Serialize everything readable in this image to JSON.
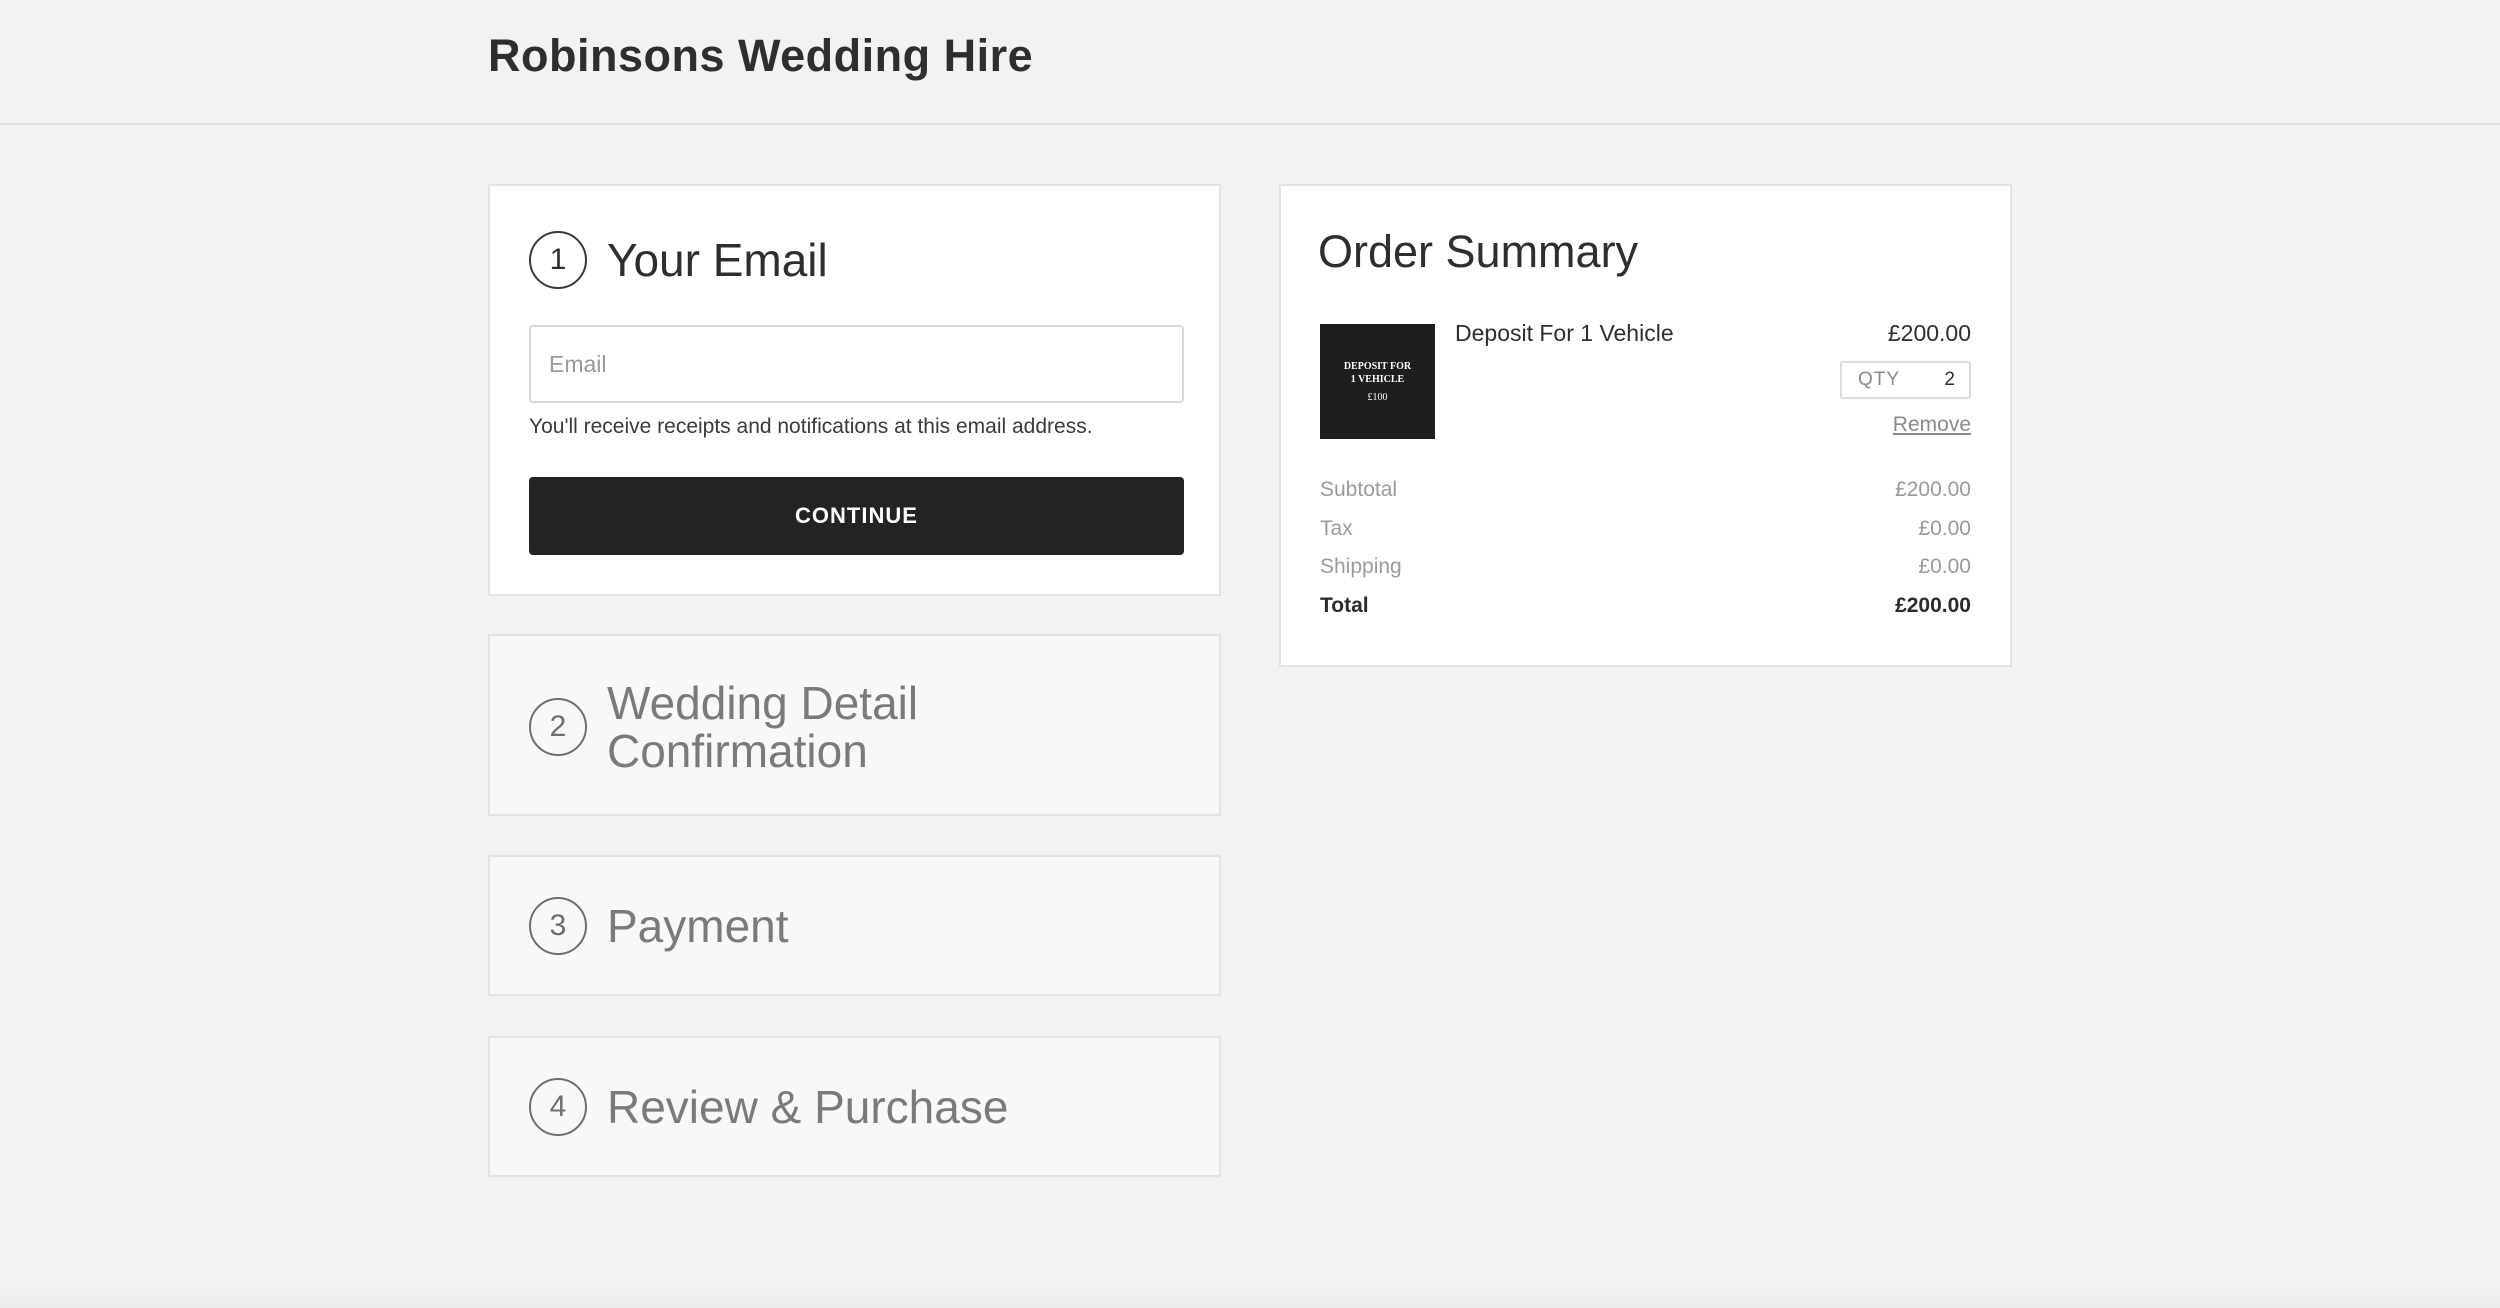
{
  "header": {
    "brand": "Robinsons Wedding Hire"
  },
  "steps": [
    {
      "number": "1",
      "title": "Your Email",
      "email_placeholder": "Email",
      "hint": "You'll receive receipts and notifications at this email address.",
      "continue_label": "CONTINUE"
    },
    {
      "number": "2",
      "title_line1": "Wedding Detail",
      "title_line2": "Confirmation"
    },
    {
      "number": "3",
      "title": "Payment"
    },
    {
      "number": "4",
      "title": "Review & Purchase"
    }
  ],
  "summary": {
    "title": "Order Summary",
    "item": {
      "thumb_line1": "DEPOSIT FOR 1 VEHICLE",
      "thumb_line2": "£100",
      "name": "Deposit For 1 Vehicle",
      "price": "£200.00",
      "qty_label": "QTY",
      "qty": "2",
      "remove_label": "Remove"
    },
    "rows": [
      {
        "label": "Subtotal",
        "value": "£200.00"
      },
      {
        "label": "Tax",
        "value": "£0.00"
      },
      {
        "label": "Shipping",
        "value": "£0.00"
      },
      {
        "label": "Total",
        "value": "£200.00"
      }
    ]
  }
}
